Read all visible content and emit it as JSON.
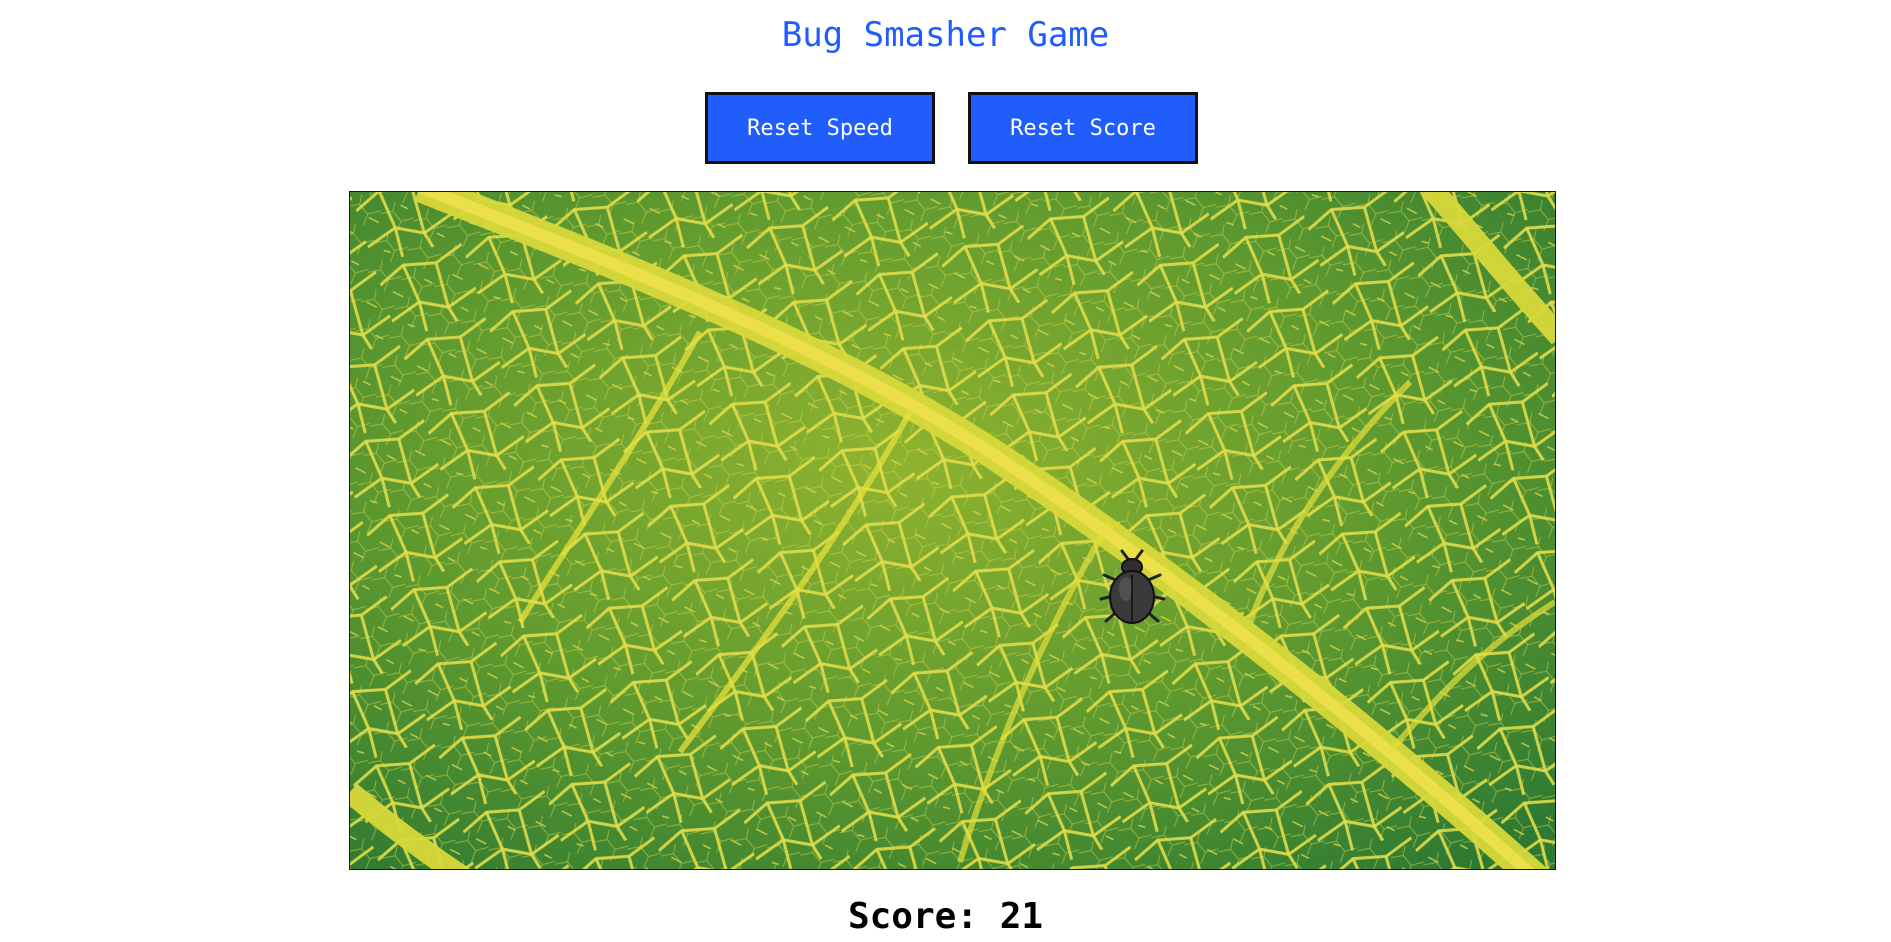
{
  "game": {
    "title": "Bug Smasher Game",
    "reset_speed_label": "Reset Speed",
    "reset_score_label": "Reset Score",
    "score_label": "Score:",
    "score_value": "21"
  },
  "colors": {
    "title": "#1f5bff",
    "button_bg": "#215dfb",
    "button_text": "#ffffff",
    "leaf_green": "#4a8a2a",
    "leaf_vein": "#e6e03a"
  },
  "icons": {
    "bug": "beetle-icon",
    "background": "leaf-texture"
  }
}
